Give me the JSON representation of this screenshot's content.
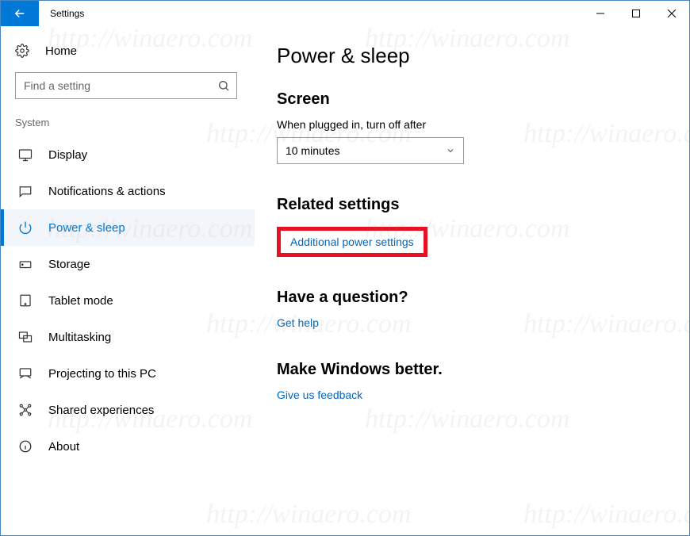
{
  "window": {
    "title": "Settings"
  },
  "sidebar": {
    "home_label": "Home",
    "search_placeholder": "Find a setting",
    "group_label": "System",
    "items": [
      {
        "key": "display",
        "label": "Display",
        "icon": "display-icon"
      },
      {
        "key": "notifications",
        "label": "Notifications & actions",
        "icon": "notifications-icon"
      },
      {
        "key": "power",
        "label": "Power & sleep",
        "icon": "power-icon",
        "active": true
      },
      {
        "key": "storage",
        "label": "Storage",
        "icon": "storage-icon"
      },
      {
        "key": "tablet",
        "label": "Tablet mode",
        "icon": "tablet-icon"
      },
      {
        "key": "multitasking",
        "label": "Multitasking",
        "icon": "multitasking-icon"
      },
      {
        "key": "projecting",
        "label": "Projecting to this PC",
        "icon": "projecting-icon"
      },
      {
        "key": "shared",
        "label": "Shared experiences",
        "icon": "shared-icon"
      },
      {
        "key": "about",
        "label": "About",
        "icon": "about-icon"
      }
    ]
  },
  "content": {
    "page_title": "Power & sleep",
    "screen": {
      "heading": "Screen",
      "field_label": "When plugged in, turn off after",
      "value": "10 minutes"
    },
    "related": {
      "heading": "Related settings",
      "link": "Additional power settings"
    },
    "question": {
      "heading": "Have a question?",
      "link": "Get help"
    },
    "feedback": {
      "heading": "Make Windows better.",
      "link": "Give us feedback"
    }
  },
  "watermark": "http://winaero.com"
}
